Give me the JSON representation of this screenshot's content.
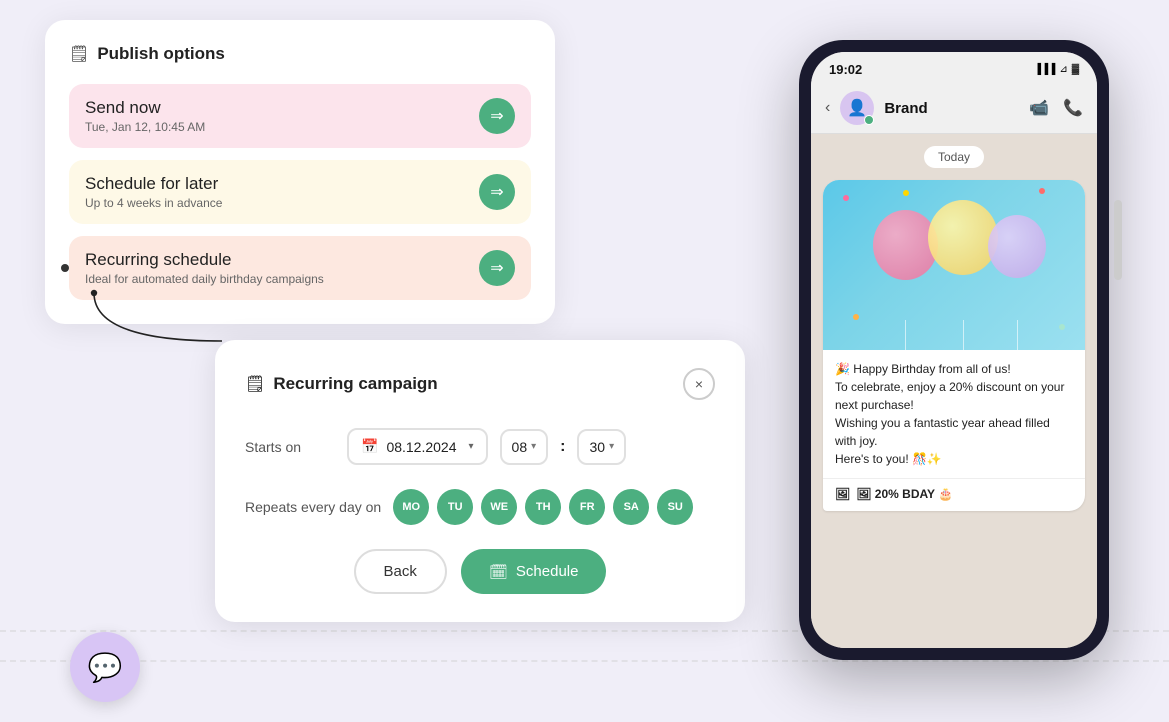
{
  "page": {
    "background": "#f0eef8"
  },
  "publish_options": {
    "title": "Publish options",
    "icon": "📋",
    "options": [
      {
        "id": "send-now",
        "label": "Send now",
        "sublabel": "Tue, Jan 12, 10:45 AM",
        "color": "pink",
        "selected": false
      },
      {
        "id": "schedule-later",
        "label": "Schedule for later",
        "sublabel": "Up to 4 weeks in advance",
        "color": "yellow",
        "selected": false
      },
      {
        "id": "recurring",
        "label": "Recurring schedule",
        "sublabel": "Ideal for automated daily birthday campaigns",
        "color": "salmon",
        "selected": true
      }
    ],
    "arrow_label": "→"
  },
  "recurring_campaign": {
    "title": "Recurring campaign",
    "icon": "📋",
    "close_label": "×",
    "starts_on_label": "Starts on",
    "date_value": "08.12.2024",
    "hour_value": "08",
    "minute_value": "30",
    "repeats_label": "Repeats every day on",
    "days": [
      {
        "key": "MO",
        "active": true
      },
      {
        "key": "TU",
        "active": true
      },
      {
        "key": "WE",
        "active": true
      },
      {
        "key": "TH",
        "active": true
      },
      {
        "key": "FR",
        "active": true
      },
      {
        "key": "SA",
        "active": true
      },
      {
        "key": "SU",
        "active": true
      }
    ],
    "back_label": "Back",
    "schedule_label": "Schedule"
  },
  "phone": {
    "time": "19:02",
    "brand_name": "Brand",
    "today_label": "Today",
    "message": {
      "text": "🎉 Happy Birthday from all of us!\nTo celebrate, enjoy a 20% discount on your next purchase!\nWishing you a fantastic year ahead filled with joy.\nHere's to you! 🎊✨",
      "footer": "🖼 20% BDAY 🎂"
    }
  },
  "bottom_icon": "💬"
}
